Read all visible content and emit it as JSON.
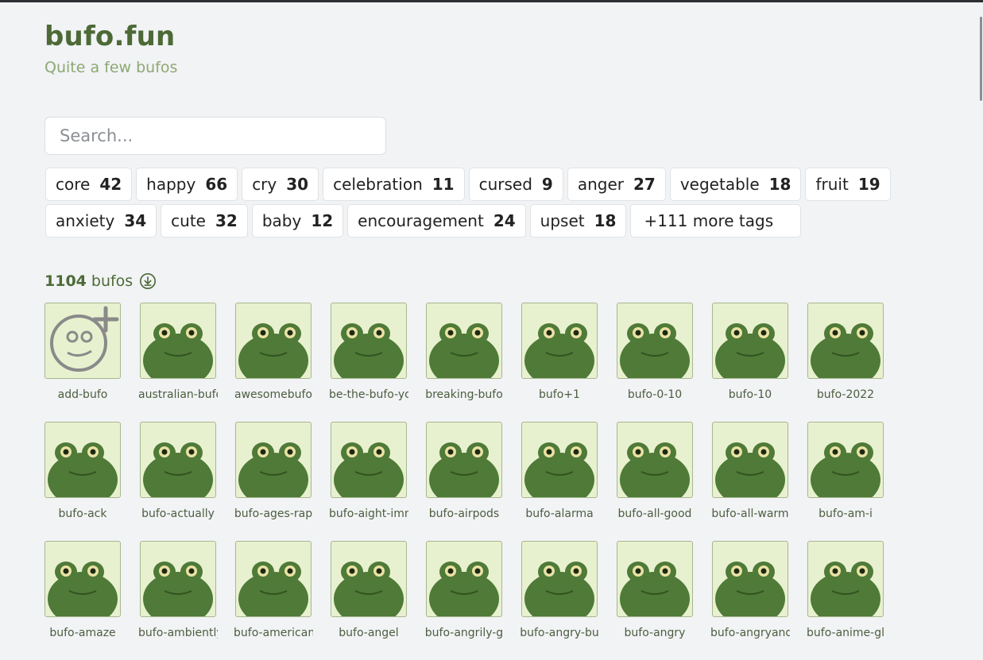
{
  "site": {
    "title": "bufo.fun",
    "subtitle": "Quite a few bufos"
  },
  "search": {
    "placeholder": "Search..."
  },
  "tags": [
    [
      {
        "label": "core",
        "count": "42"
      },
      {
        "label": "happy",
        "count": "66"
      },
      {
        "label": "cry",
        "count": "30"
      },
      {
        "label": "celebration",
        "count": "11"
      },
      {
        "label": "cursed",
        "count": "9"
      },
      {
        "label": "anger",
        "count": "27"
      },
      {
        "label": "vegetable",
        "count": "18"
      },
      {
        "label": "fruit",
        "count": "19"
      }
    ],
    [
      {
        "label": "anxiety",
        "count": "34"
      },
      {
        "label": "cute",
        "count": "32"
      },
      {
        "label": "baby",
        "count": "12"
      },
      {
        "label": "encouragement",
        "count": "24"
      },
      {
        "label": "upset",
        "count": "18"
      }
    ]
  ],
  "more_tags": "+111 more tags",
  "results": {
    "count": "1104",
    "unit": "bufos",
    "download_icon": "download-circle-icon"
  },
  "bufos": [
    [
      "add-bufo",
      "australian-bufo",
      "awesomebufo",
      "be-the-bufo-you",
      "breaking-bufo",
      "bufo+1",
      "bufo-0-10",
      "bufo-10",
      "bufo-2022"
    ],
    [
      "bufo-ack",
      "bufo-actually",
      "bufo-ages-rap",
      "bufo-aight-imma",
      "bufo-airpods",
      "bufo-alarma",
      "bufo-all-good",
      "bufo-all-warm",
      "bufo-am-i"
    ],
    [
      "bufo-amaze",
      "bufo-ambiently",
      "bufo-american",
      "bufo-angel",
      "bufo-angrily-g",
      "bufo-angry-bu",
      "bufo-angry",
      "bufo-angryand",
      "bufo-anime-gl"
    ]
  ],
  "colors": {
    "accent": "#4d6a36",
    "subtitle": "#8ea873",
    "thumb_bg": "#e8f1cf",
    "frog": "#4f7a38"
  }
}
